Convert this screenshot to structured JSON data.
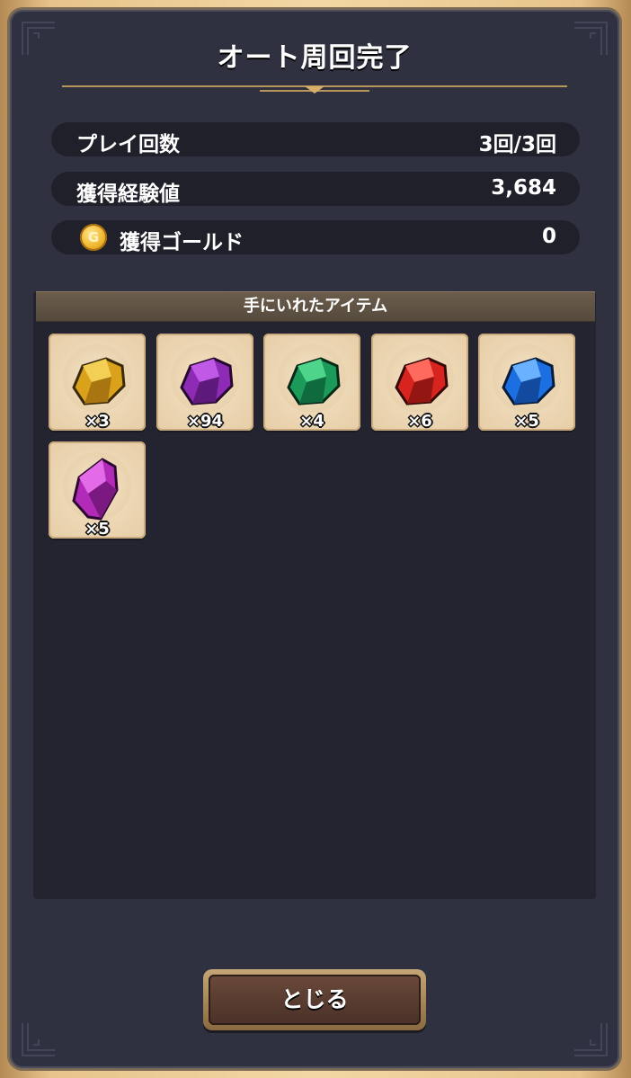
{
  "dialog": {
    "title": "オート周回完了",
    "close_label": "とじる"
  },
  "stats": [
    {
      "label": "プレイ回数",
      "value": "3回/3回"
    },
    {
      "label": "獲得経験値",
      "value": "3,684"
    },
    {
      "label": "獲得ゴールド",
      "value": "0",
      "icon": "gold-coin-icon",
      "icon_letter": "G"
    }
  ],
  "items_section": {
    "header": "手にいれたアイテム",
    "items": [
      {
        "name": "yellow-crystal-icon",
        "color": "#d9a21a",
        "qty": "×3"
      },
      {
        "name": "purple-crystal-icon",
        "color": "#8e2bb5",
        "qty": "×94"
      },
      {
        "name": "green-crystal-icon",
        "color": "#1c9a5a",
        "qty": "×4"
      },
      {
        "name": "red-crystal-icon",
        "color": "#d8241f",
        "qty": "×6"
      },
      {
        "name": "blue-crystal-icon",
        "color": "#1c6fe0",
        "qty": "×5"
      },
      {
        "name": "magenta-crystal-shard-icon",
        "color": "#b22ab8",
        "qty": "×5"
      }
    ]
  }
}
